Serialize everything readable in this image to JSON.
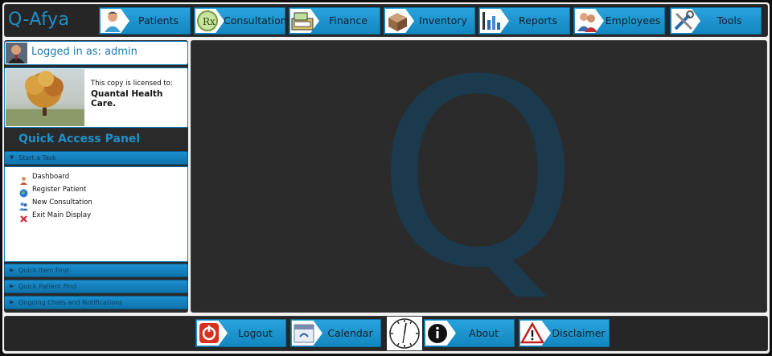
{
  "app": {
    "title": "Q-Afya"
  },
  "nav": {
    "items": [
      {
        "label": "Patients",
        "icon": "patients-icon"
      },
      {
        "label": "Consultations",
        "icon": "rx-icon"
      },
      {
        "label": "Finance",
        "icon": "cash-register-icon"
      },
      {
        "label": "Inventory",
        "icon": "box-icon"
      },
      {
        "label": "Reports",
        "icon": "report-icon"
      },
      {
        "label": "Employees",
        "icon": "employees-icon"
      },
      {
        "label": "Tools",
        "icon": "tools-icon"
      }
    ]
  },
  "sidebar": {
    "login_text": "Logged in as: admin",
    "license_line1": "This copy is licensed to:",
    "license_line2": "Quantal Health Care.",
    "panel_title": "Quick Access Panel",
    "sections": [
      {
        "label": "Start a Task",
        "expanded": true
      },
      {
        "label": "Quick Item Find",
        "expanded": false
      },
      {
        "label": "Quick Patient Find",
        "expanded": false
      },
      {
        "label": "Ongoing Chats and Notifications",
        "expanded": false
      }
    ],
    "tasks": [
      {
        "label": "Dashboard",
        "icon": "user-icon"
      },
      {
        "label": "Register Patient",
        "icon": "globe-icon"
      },
      {
        "label": "New Consultation",
        "icon": "people-icon"
      },
      {
        "label": "Exit Main Display",
        "icon": "close-icon"
      }
    ]
  },
  "main": {
    "watermark": "Q"
  },
  "footer": {
    "buttons": [
      {
        "label": "Logout",
        "icon": "power-icon"
      },
      {
        "label": "Calendar",
        "icon": "calendar-icon"
      },
      {
        "label": "About",
        "icon": "info-icon"
      },
      {
        "label": "Disclaimer",
        "icon": "warning-icon"
      }
    ]
  },
  "colors": {
    "accent": "#1f8fc9",
    "button": "#1a93cf",
    "background": "#2b2b2b"
  }
}
